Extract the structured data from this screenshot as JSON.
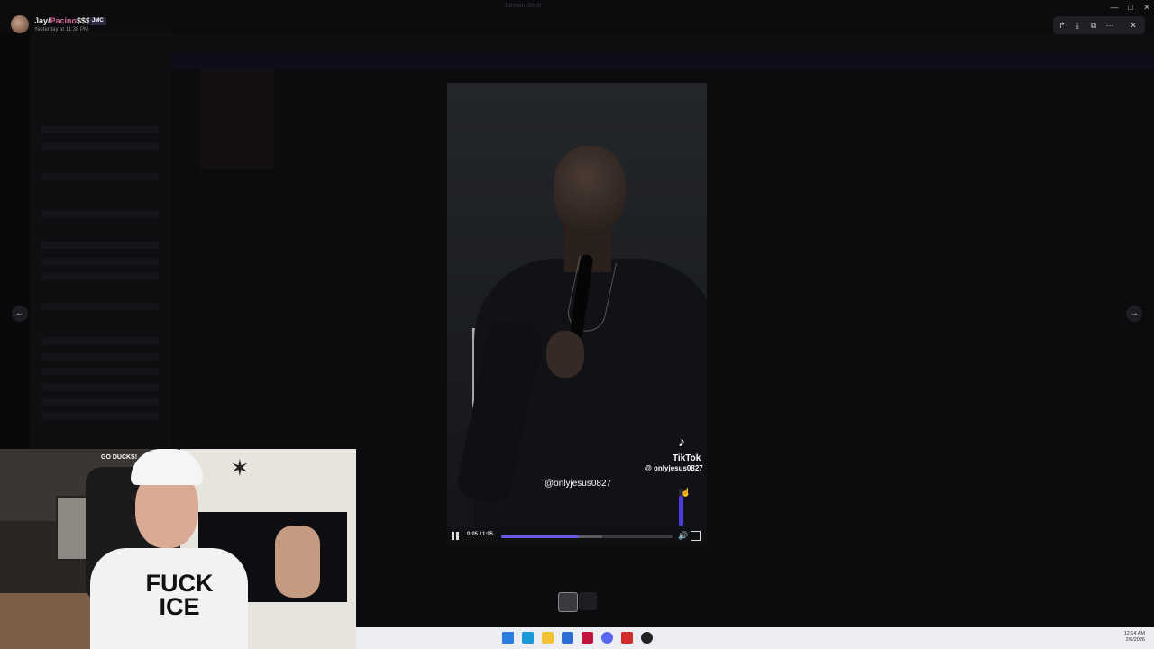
{
  "post": {
    "author_prefix": "Jay/",
    "author_accent": "Pacino",
    "author_suffix": "$$$",
    "badge": "JMC",
    "timestamp": "Yesterday at 11:38 PM"
  },
  "window": {
    "title": "Stream Sesh",
    "minimize": "—",
    "maximize": "□",
    "close": "✕"
  },
  "viewer_tools": {
    "forward": "↱",
    "download": "⤓",
    "open": "⧉",
    "more": "⋯",
    "close": "✕"
  },
  "nav": {
    "prev": "←",
    "next": "→"
  },
  "video": {
    "watermark_logo": "♪",
    "watermark_name": "TikTok",
    "watermark_handle": "@ onlyjesus0827",
    "caption_handle": "@onlyjesus0827",
    "time": "0:05 / 1:05",
    "progress": 0.45,
    "buffered": 0.14,
    "volume": 0.8,
    "speaker_symbol": "🔊"
  },
  "webcam": {
    "shirt_text": "FUCK ICE",
    "sign_text": "GO DUCKS!"
  },
  "taskbar": {
    "time": "12:14 AM",
    "date": "2/6/2026",
    "icons": [
      {
        "name": "windows-start-icon",
        "color": "#2b7de0"
      },
      {
        "name": "edge-icon",
        "color": "#1a9ad8"
      },
      {
        "name": "file-explorer-icon",
        "color": "#f2c230"
      },
      {
        "name": "store-icon",
        "color": "#2b6fd6"
      },
      {
        "name": "terminal-icon",
        "color": "#c0143c"
      },
      {
        "name": "discord-icon",
        "color": "#5865f2"
      },
      {
        "name": "app-icon",
        "color": "#d02c2c"
      },
      {
        "name": "media-player-icon",
        "color": "#222222"
      }
    ]
  }
}
